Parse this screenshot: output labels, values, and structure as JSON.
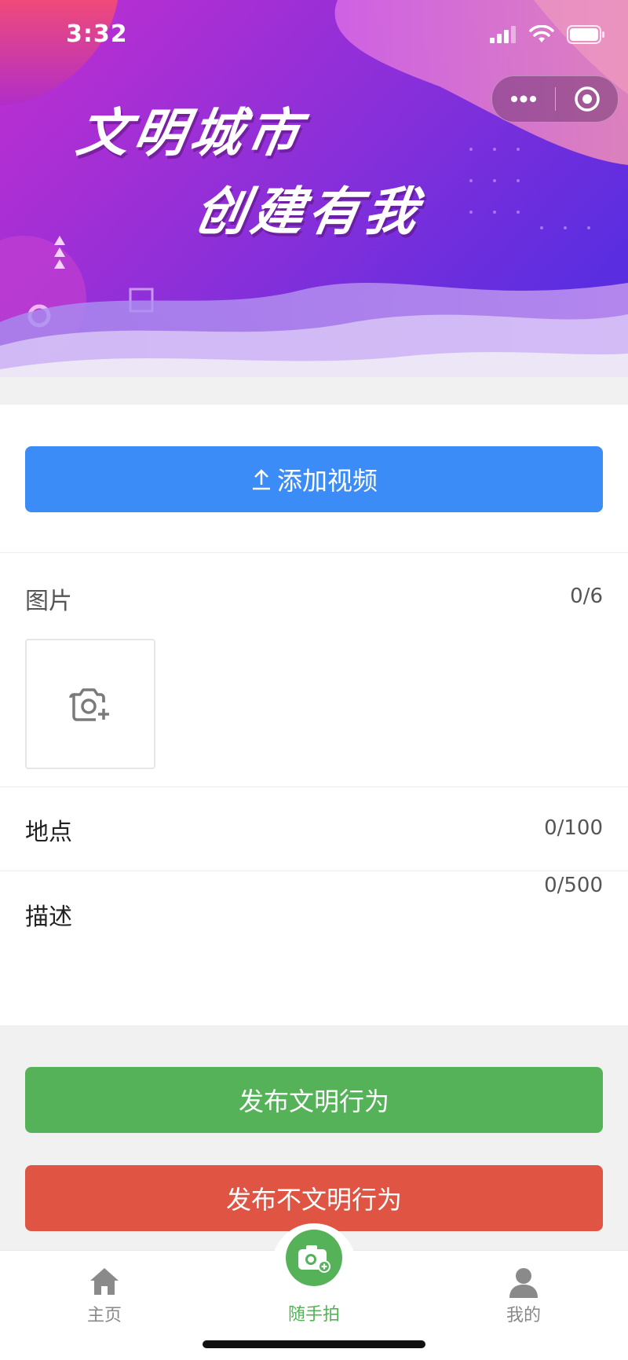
{
  "status_bar": {
    "time": "3:32"
  },
  "banner": {
    "slogan_line1": "文明城市",
    "slogan_line2": "创建有我"
  },
  "video": {
    "add_video_label": "添加视频",
    "icon": "upload-icon"
  },
  "images": {
    "label": "图片",
    "count": "0/6",
    "icon": "camera-plus-icon"
  },
  "location": {
    "label": "地点",
    "count": "0/100"
  },
  "description": {
    "label": "描述",
    "count": "0/500"
  },
  "actions": {
    "publish_civil": "发布文明行为",
    "publish_uncivil": "发布不文明行为"
  },
  "tabbar": {
    "home": "主页",
    "snap": "随手拍",
    "mine": "我的"
  },
  "colors": {
    "blue_button": "#3b8cf6",
    "green_button": "#55b259",
    "red_button": "#e05444",
    "active_tab": "#55b259",
    "banner_purple": "#9a2bd6"
  }
}
